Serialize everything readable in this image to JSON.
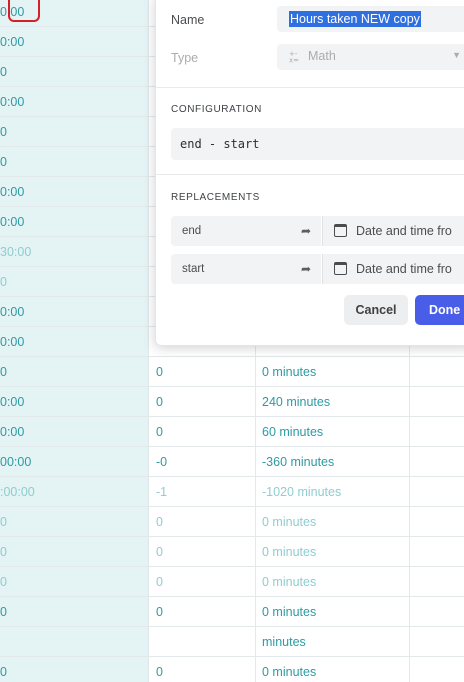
{
  "background_table": {
    "rows": [
      {
        "a": "0:00",
        "b": "",
        "c": ""
      },
      {
        "a": "0:00",
        "b": "",
        "c": ""
      },
      {
        "a": "0",
        "b": "",
        "c": ""
      },
      {
        "a": "0:00",
        "b": "",
        "c": ""
      },
      {
        "a": "0",
        "b": "",
        "c": ""
      },
      {
        "a": "0",
        "b": "",
        "c": ""
      },
      {
        "a": "0:00",
        "b": "",
        "c": ""
      },
      {
        "a": "0:00",
        "b": "",
        "c": ""
      },
      {
        "a": "30:00",
        "b": "",
        "c": "",
        "faded": true
      },
      {
        "a": "0",
        "b": "",
        "c": "",
        "faded": true
      },
      {
        "a": "0:00",
        "b": "",
        "c": ""
      },
      {
        "a": "0:00",
        "b": "",
        "c": ""
      },
      {
        "a": "0",
        "b": "0",
        "c": "0 minutes"
      },
      {
        "a": "0:00",
        "b": "0",
        "c": "240 minutes"
      },
      {
        "a": "0:00",
        "b": "0",
        "c": "60 minutes"
      },
      {
        "a": "00:00",
        "b": "-0",
        "c": "-360 minutes"
      },
      {
        "a": ":00:00",
        "b": "-1",
        "c": "-1020 minutes",
        "faded": true
      },
      {
        "a": "0",
        "b": "0",
        "c": "0 minutes",
        "faded": true
      },
      {
        "a": "0",
        "b": "0",
        "c": "0 minutes",
        "faded": true
      },
      {
        "a": "0",
        "b": "0",
        "c": "0 minutes",
        "faded": true
      },
      {
        "a": "0",
        "b": "0",
        "c": "0 minutes"
      },
      {
        "a": "",
        "b": "",
        "c": "minutes"
      },
      {
        "a": "0",
        "b": "0",
        "c": "0 minutes"
      }
    ]
  },
  "popup": {
    "name_label": "Name",
    "name_value": "Hours taken NEW copy",
    "type_label": "Type",
    "type_value": "Math",
    "configuration_heading": "CONFIGURATION",
    "formula": "end - start",
    "replacements_heading": "REPLACEMENTS",
    "replacements": [
      {
        "name": "end",
        "value": "Date and time fro"
      },
      {
        "name": "start",
        "value": "Date and time fro"
      }
    ],
    "cancel_label": "Cancel",
    "done_label": "Done"
  },
  "colors": {
    "accent": "#4a5de8",
    "selection": "#2f6fe0",
    "teal_text": "#2d9ba3",
    "annotation": "#d71e2a"
  }
}
